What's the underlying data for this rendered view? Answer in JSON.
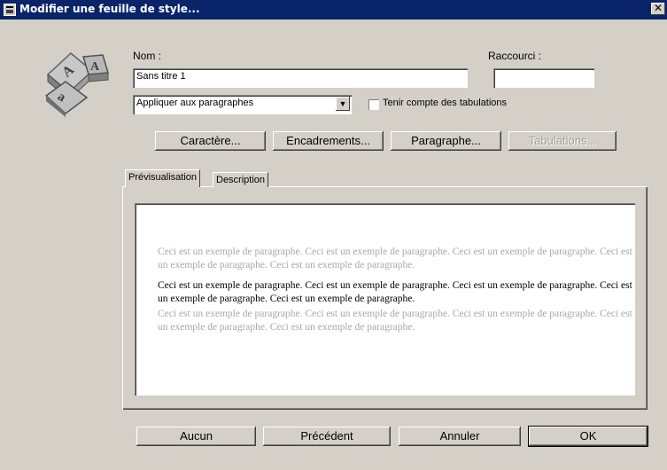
{
  "window": {
    "title": "Modifier une feuille de style...",
    "close_glyph": "✕"
  },
  "form": {
    "name_label": "Nom :",
    "name_value": "Sans titre 1",
    "shortcut_label": "Raccourci :",
    "shortcut_value": "",
    "apply_select_value": "Appliquer aux paragraphes",
    "tabs_checkbox_label": "Tenir compte des tabulations",
    "tabs_checkbox_checked": false
  },
  "format_buttons": {
    "character": "Caractère...",
    "borders": "Encadrements...",
    "paragraph": "Paragraphe...",
    "tabulations": "Tabulations..."
  },
  "tabs": [
    {
      "label": "Prévisualisation",
      "active": true
    },
    {
      "label": "Description",
      "active": false
    }
  ],
  "preview": {
    "before": "Ceci est un exemple de paragraphe. Ceci est un exemple de paragraphe. Ceci est un exemple de paragraphe. Ceci est un exemple de paragraphe. Ceci est un exemple de paragraphe.",
    "current": "Ceci est un exemple de paragraphe. Ceci est un exemple de paragraphe. Ceci est un exemple de paragraphe. Ceci est un exemple de paragraphe. Ceci est un exemple de paragraphe.",
    "after": "Ceci est un exemple de paragraphe. Ceci est un exemple de paragraphe. Ceci est un exemple de paragraphe. Ceci est un exemple de paragraphe. Ceci est un exemple de paragraphe."
  },
  "bottom_buttons": {
    "none": "Aucun",
    "previous": "Précédent",
    "cancel": "Annuler",
    "ok": "OK"
  },
  "colors": {
    "titlebar": "#0a246a",
    "face": "#d4d0c8",
    "preview_grey": "#a8a8a8"
  }
}
